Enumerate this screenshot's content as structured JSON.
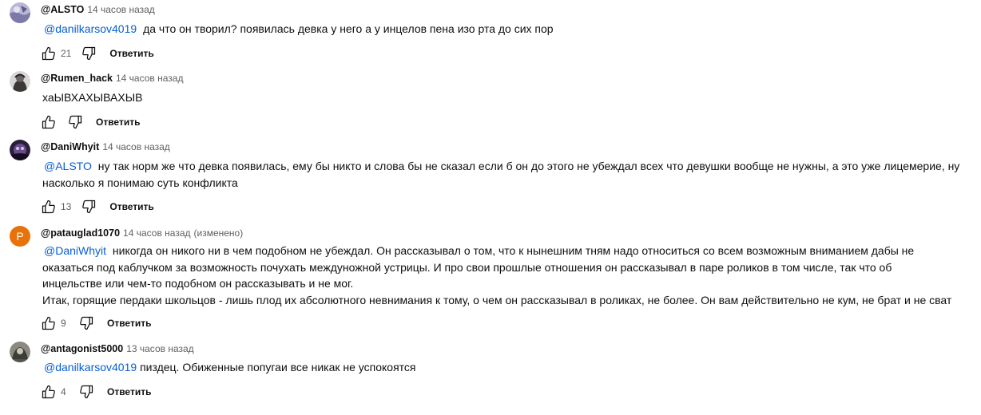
{
  "comments": [
    {
      "author": "@ALSTO",
      "time": "14 часов назад",
      "edited": "",
      "mention": "@danilkarsov4019",
      "lines": [
        "да что он творил? появилась девка у него а у инцелов пена изо рта до сих пор"
      ],
      "likes": "21",
      "reply_label": "Ответить"
    },
    {
      "author": "@Rumen_hack",
      "time": "14 часов назад",
      "edited": "",
      "mention": "",
      "lines": [
        "хаЫВХАХЫВАХЫВ"
      ],
      "likes": "",
      "reply_label": "Ответить"
    },
    {
      "author": "@DaniWhyit",
      "time": "14 часов назад",
      "edited": "",
      "mention": "@ALSTO",
      "lines": [
        "ну так норм же что девка появилась, ему бы никто и слова бы не сказал если б он до этого не убеждал всех что девушки вообще не нужны, а это уже лицемерие, ну",
        "насколько я понимаю суть конфликта"
      ],
      "likes": "13",
      "reply_label": "Ответить"
    },
    {
      "author": "@patauglad1070",
      "time": "14 часов назад",
      "edited": "(изменено)",
      "avatar_letter": "P",
      "mention": "@DaniWhyit",
      "lines": [
        "никогда он никого ни в чем подобном не убеждал. Он рассказывал о том, что к нынешним тням надо относиться со всем возможным вниманием дабы не",
        "оказаться под каблучком за возможность почухать междуножной устрицы. И про свои прошлые отношения он рассказывал в паре роликов в том числе, так что об",
        "инцельстве или чем-то подобном он рассказывать и не мог.",
        "Итак, горящие пердаки школьцов - лишь плод их абсолютного невнимания к тому, о чем он рассказывал в роликах, не более. Он вам действительно не кум, не брат и не сват"
      ],
      "likes": "9",
      "reply_label": "Ответить"
    },
    {
      "author": "@antagonist5000",
      "time": "13 часов назад",
      "edited": "",
      "mention": "@danilkarsov4019",
      "lines": [
        "пиздец. Обиженные попугаи все никак не успокоятся"
      ],
      "likes": "4",
      "reply_label": "Ответить"
    }
  ],
  "colors": {
    "mention": "#065fd4",
    "meta": "#606060",
    "text": "#0f0f0f",
    "avatar_p": "#e8710a"
  },
  "icons": [
    "like-icon",
    "dislike-icon"
  ]
}
